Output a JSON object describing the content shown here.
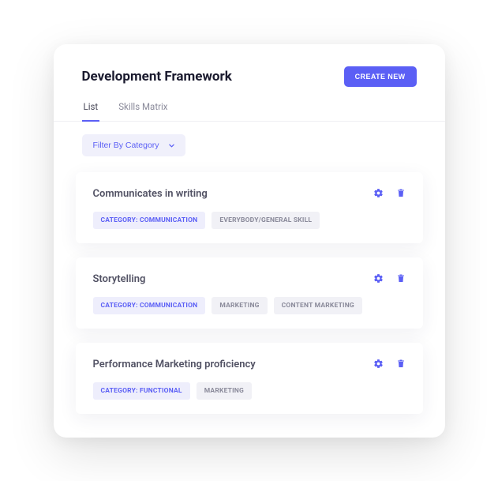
{
  "header": {
    "title": "Development Framework",
    "create_label": "CREATE NEW"
  },
  "tabs": [
    {
      "label": "List",
      "active": true
    },
    {
      "label": "Skills Matrix",
      "active": false
    }
  ],
  "filter": {
    "label": "Filter By Category"
  },
  "skills": [
    {
      "title": "Communicates in writing",
      "tags": [
        {
          "label": "CATEGORY: COMMUNICATION",
          "primary": true
        },
        {
          "label": "EVERYBODY/GENERAL SKILL",
          "primary": false
        }
      ]
    },
    {
      "title": "Storytelling",
      "tags": [
        {
          "label": "CATEGORY: COMMUNICATION",
          "primary": true
        },
        {
          "label": "MARKETING",
          "primary": false
        },
        {
          "label": "CONTENT MARKETING",
          "primary": false
        }
      ]
    },
    {
      "title": "Performance Marketing proficiency",
      "tags": [
        {
          "label": "CATEGORY: FUNCTIONAL",
          "primary": true
        },
        {
          "label": "MARKETING",
          "primary": false
        }
      ]
    }
  ]
}
